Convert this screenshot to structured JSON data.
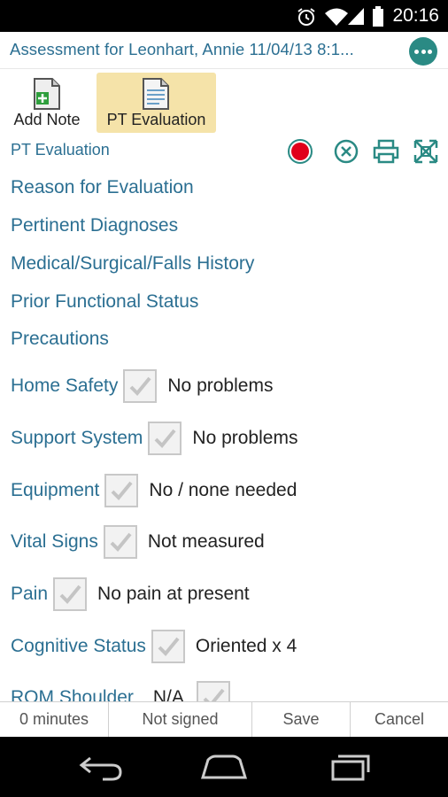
{
  "status_bar": {
    "time": "20:16"
  },
  "header": {
    "title": "Assessment for Leonhart, Annie  11/04/13  8:1..."
  },
  "toolbar": {
    "add_note_label": "Add Note",
    "pt_evaluation_label": "PT Evaluation"
  },
  "subheader": {
    "title": "PT Evaluation"
  },
  "sections": [
    "Reason for Evaluation",
    "Pertinent Diagnoses",
    "Medical/Surgical/Falls History",
    "Prior Functional Status",
    "Precautions"
  ],
  "checks": [
    {
      "label": "Home Safety",
      "value": "No problems",
      "checked": true
    },
    {
      "label": "Support System",
      "value": "No problems",
      "checked": true
    },
    {
      "label": "Equipment",
      "value": "No / none needed",
      "checked": true
    },
    {
      "label": "Vital Signs",
      "value": "Not measured",
      "checked": true
    },
    {
      "label": "Pain",
      "value": "No pain at present",
      "checked": true
    },
    {
      "label": "Cognitive Status",
      "value": "Oriented x 4",
      "checked": true
    },
    {
      "label": "ROM Shoulder",
      "value": "N/A",
      "checked": true
    }
  ],
  "footer": {
    "minutes": "0 minutes",
    "signed": "Not signed",
    "save": "Save",
    "cancel": "Cancel"
  },
  "colors": {
    "accent_text": "#2b6f92",
    "active_tab": "#f5e3a9",
    "record": "#e0001a",
    "teal": "#2a8a84"
  },
  "icons": [
    "alarm-icon",
    "wifi-icon",
    "signal-icon",
    "battery-icon",
    "more-icon",
    "add-note-icon",
    "pt-evaluation-icon",
    "record-icon",
    "cancel-icon",
    "print-icon",
    "expand-icon",
    "checkmark-icon",
    "back-icon",
    "home-icon",
    "recents-icon"
  ]
}
